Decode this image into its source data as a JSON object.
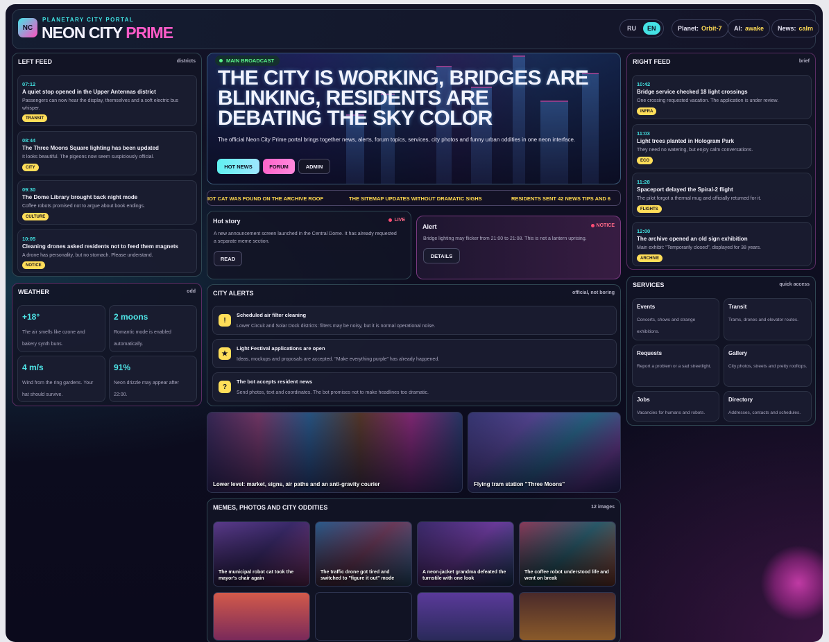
{
  "header": {
    "logo": "NC",
    "kicker": "PLANETARY CITY PORTAL",
    "title_main": "NEON CITY ",
    "title_accent": "PRIME",
    "lang_ru": "RU",
    "lang_en": "EN",
    "planet_label": "Planet:",
    "planet_value": "Orbit-7",
    "ai_label": "AI:",
    "ai_value": "awake",
    "news_label": "News:",
    "news_value": "calm"
  },
  "left_feed": {
    "title": "LEFT FEED",
    "right": "districts",
    "items": [
      {
        "time": "07:12",
        "title": "A quiet stop opened in the Upper Antennas district",
        "desc": "Passengers can now hear the display, themselves and a soft electric bus whisper.",
        "tag": "TRANSIT"
      },
      {
        "time": "08:44",
        "title": "The Three Moons Square lighting has been updated",
        "desc": "It looks beautiful. The pigeons now seem suspiciously official.",
        "tag": "CITY"
      },
      {
        "time": "09:30",
        "title": "The Dome Library brought back night mode",
        "desc": "Coffee robots promised not to argue about book endings.",
        "tag": "CULTURE"
      },
      {
        "time": "10:05",
        "title": "Cleaning drones asked residents not to feed them magnets",
        "desc": "A drone has personality, but no stomach. Please understand.",
        "tag": "NOTICE"
      }
    ]
  },
  "weather": {
    "title": "WEATHER",
    "right": "odd",
    "items": [
      {
        "value": "+18°",
        "desc": "The air smells like ozone and bakery synth buns."
      },
      {
        "value": "2 moons",
        "desc": "Romantic mode is enabled automatically."
      },
      {
        "value": "4 m/s",
        "desc": "Wind from the ring gardens. Your hat should survive."
      },
      {
        "value": "91%",
        "desc": "Neon drizzle may appear after 22:00."
      }
    ]
  },
  "hero": {
    "badge": "MAIN BROADCAST",
    "title": "THE CITY IS WORKING, BRIDGES ARE BLINKING, RESIDENTS ARE DEBATING THE SKY COLOR",
    "desc": "The official Neon City Prime portal brings together news, alerts, forum topics, services, city photos and funny urban oddities in one neon interface.",
    "btn_hot": "HOT NEWS",
    "btn_forum": "FORUM",
    "btn_admin": "ADMIN"
  },
  "ticker": {
    "items": [
      "IOT CAT WAS FOUND ON THE ARCHIVE ROOF",
      "THE SITEMAP UPDATES WITHOUT DRAMATIC SIGHS",
      "RESIDENTS SENT 42 NEWS TIPS AND 6"
    ]
  },
  "hot_story": {
    "title": "Hot story",
    "badge": "LIVE",
    "desc": "A new announcement screen launched in the Central Dome. It has already requested a separate meme section.",
    "button": "READ"
  },
  "alert": {
    "title": "Alert",
    "badge": "NOTICE",
    "desc": "Bridge lighting may flicker from 21:00 to 21:08. This is not a lantern uprising.",
    "button": "DETAILS"
  },
  "city_alerts": {
    "title": "CITY ALERTS",
    "right": "official, not boring",
    "items": [
      {
        "icon": "!",
        "title": "Scheduled air filter cleaning",
        "desc": "Lower Circuit and Solar Dock districts: filters may be noisy, but it is normal operational noise."
      },
      {
        "icon": "★",
        "title": "Light Festival applications are open",
        "desc": "Ideas, mockups and proposals are accepted. \"Make everything purple\" has already happened."
      },
      {
        "icon": "?",
        "title": "The bot accepts resident news",
        "desc": "Send photos, text and coordinates. The bot promises not to make headlines too dramatic."
      }
    ]
  },
  "photos": [
    {
      "caption": "Lower level: market, signs, air paths and an anti-gravity courier"
    },
    {
      "caption": "Flying tram station \"Three Moons\""
    }
  ],
  "memes": {
    "title": "MEMES, PHOTOS AND CITY ODDITIES",
    "right": "12 images",
    "items": [
      {
        "caption": "The municipal robot cat took the mayor's chair again"
      },
      {
        "caption": "The traffic drone got tired and switched to \"figure it out\" mode"
      },
      {
        "caption": "A neon-jacket grandma defeated the turnstile with one look"
      },
      {
        "caption": "The coffee robot understood life and went on break"
      }
    ]
  },
  "right_feed": {
    "title": "RIGHT FEED",
    "right": "brief",
    "items": [
      {
        "time": "10:42",
        "title": "Bridge service checked 18 light crossings",
        "desc": "One crossing requested vacation. The application is under review.",
        "tag": "INFRA"
      },
      {
        "time": "11:03",
        "title": "Light trees planted in Hologram Park",
        "desc": "They need no watering, but enjoy calm conversations.",
        "tag": "ECO"
      },
      {
        "time": "11:28",
        "title": "Spaceport delayed the Spiral-2 flight",
        "desc": "The pilot forgot a thermal mug and officially returned for it.",
        "tag": "FLIGHTS"
      },
      {
        "time": "12:00",
        "title": "The archive opened an old sign exhibition",
        "desc": "Main exhibit: \"Temporarily closed\", displayed for 38 years.",
        "tag": "ARCHIVE"
      }
    ]
  },
  "services": {
    "title": "SERVICES",
    "right": "quick access",
    "items": [
      {
        "title": "Events",
        "desc": "Concerts, shows and strange exhibitions."
      },
      {
        "title": "Transit",
        "desc": "Trams, drones and elevator routes."
      },
      {
        "title": "Requests",
        "desc": "Report a problem or a sad streetlight."
      },
      {
        "title": "Gallery",
        "desc": "City photos, streets and pretty rooftops."
      },
      {
        "title": "Jobs",
        "desc": "Vacancies for humans and robots."
      },
      {
        "title": "Directory",
        "desc": "Addresses, contacts and schedules."
      }
    ]
  },
  "colors": {
    "cyan": "#42e3e3",
    "pink": "#ff5bc8",
    "yellow": "#ffde59",
    "bg": "#0d0d1f"
  }
}
